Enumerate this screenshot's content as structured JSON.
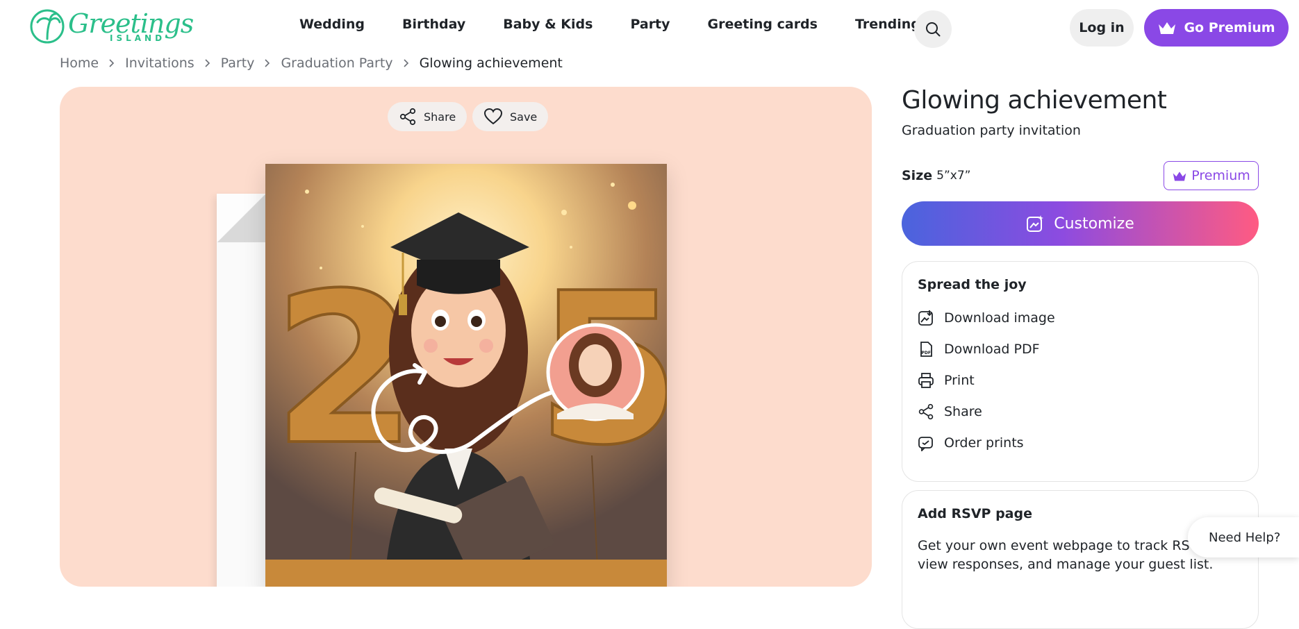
{
  "brand": {
    "script": "Greetings",
    "sub": "ISLAND"
  },
  "nav": {
    "items": [
      {
        "label": "Wedding"
      },
      {
        "label": "Birthday"
      },
      {
        "label": "Baby & Kids"
      },
      {
        "label": "Party"
      },
      {
        "label": "Greeting cards"
      },
      {
        "label": "Trending"
      }
    ],
    "login_label": "Log in",
    "premium_label": "Go Premium"
  },
  "breadcrumb": [
    "Home",
    "Invitations",
    "Party",
    "Graduation Party",
    "Glowing achievement"
  ],
  "preview": {
    "share_label": "Share",
    "save_label": "Save",
    "card_number": "25"
  },
  "product": {
    "title": "Glowing achievement",
    "subtitle": "Graduation party invitation",
    "size_label": "Size",
    "size_value": "5”x7”",
    "premium_tag": "Premium",
    "customize_label": "Customize"
  },
  "spread_joy": {
    "title": "Spread the joy",
    "items": [
      {
        "label": "Download image",
        "icon": "download-image-icon"
      },
      {
        "label": "Download PDF",
        "icon": "pdf-icon"
      },
      {
        "label": "Print",
        "icon": "printer-icon"
      },
      {
        "label": "Share",
        "icon": "share-icon"
      },
      {
        "label": "Order prints",
        "icon": "order-prints-icon"
      }
    ]
  },
  "rsvp": {
    "title": "Add RSVP page",
    "description": "Get your own event webpage to track RSVPs, view responses, and manage your guest list."
  },
  "help": {
    "label": "Need Help?"
  },
  "colors": {
    "accent": "#8a48e6",
    "brand_green": "#2bbf8a",
    "preview_bg": "#fddccd"
  }
}
